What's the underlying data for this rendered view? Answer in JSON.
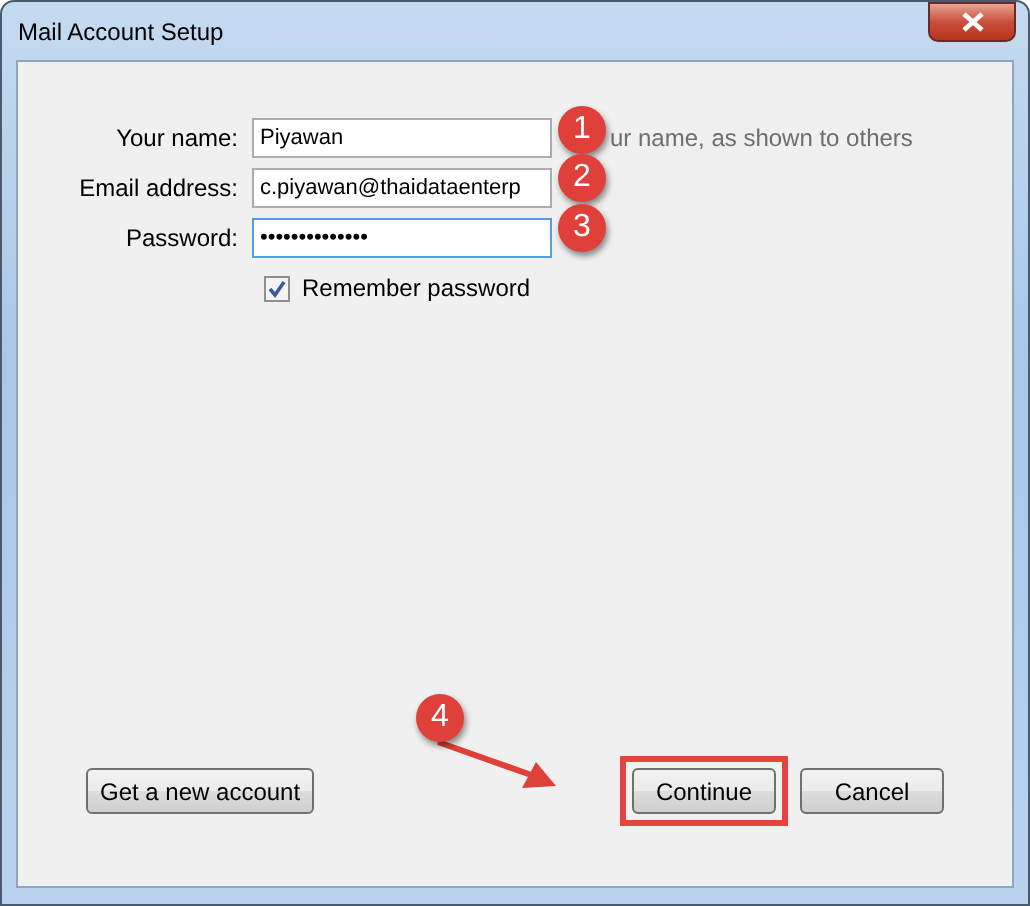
{
  "window": {
    "title": "Mail Account Setup"
  },
  "fields": [
    {
      "label": "Your name:",
      "value": "Piyawan",
      "hint": "ur name, as shown to others",
      "focused": false
    },
    {
      "label": "Email address:",
      "value": "c.piyawan@thaidataenterp",
      "focused": false
    },
    {
      "label": "Password:",
      "value": "••••••••••••••",
      "focused": true
    }
  ],
  "remember_password": {
    "label": "Remember password",
    "checked": true
  },
  "buttons": [
    {
      "label": "Get a new account",
      "highlighted": false
    },
    {
      "label": "Continue",
      "highlighted": true
    },
    {
      "label": "Cancel",
      "highlighted": false
    }
  ],
  "annotations": [
    "1",
    "2",
    "3",
    "4"
  ]
}
